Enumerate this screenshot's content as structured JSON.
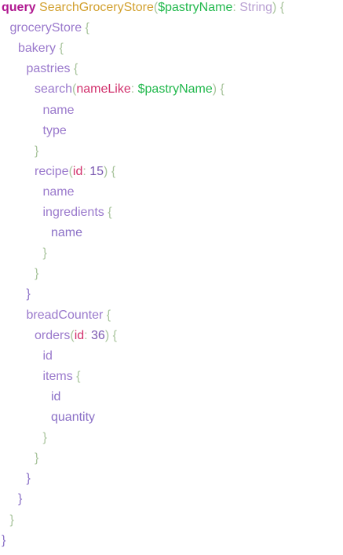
{
  "colors": {
    "keyword": "#b01890",
    "operation": "#d2a02e",
    "variable": "#21b84c",
    "type": "#b9a0d2",
    "field": "#9a79cc",
    "argument": "#d1306c",
    "number": "#7a58b0",
    "punctuation": "#a8c49c"
  },
  "editor": {
    "lines": [
      {
        "indent": 0,
        "tokens": [
          {
            "t": "query",
            "c": "tok-kw"
          },
          {
            "t": " ",
            "c": ""
          },
          {
            "t": "SearchGroceryStore",
            "c": "tok-op"
          },
          {
            "t": "(",
            "c": "tok-punct"
          },
          {
            "t": "$pastryName",
            "c": "tok-var"
          },
          {
            "t": ": ",
            "c": "tok-punct"
          },
          {
            "t": "String",
            "c": "tok-type"
          },
          {
            "t": ") {",
            "c": "tok-punct"
          }
        ]
      },
      {
        "indent": 1,
        "tokens": [
          {
            "t": "groceryStore",
            "c": "tok-field"
          },
          {
            "t": " {",
            "c": "tok-brace"
          }
        ]
      },
      {
        "indent": 2,
        "tokens": [
          {
            "t": "bakery",
            "c": "tok-field"
          },
          {
            "t": " {",
            "c": "tok-brace"
          }
        ]
      },
      {
        "indent": 3,
        "tokens": [
          {
            "t": "pastries",
            "c": "tok-field"
          },
          {
            "t": " {",
            "c": "tok-brace"
          }
        ]
      },
      {
        "indent": 4,
        "tokens": [
          {
            "t": "search",
            "c": "tok-field"
          },
          {
            "t": "(",
            "c": "tok-punct"
          },
          {
            "t": "nameLike",
            "c": "tok-arg"
          },
          {
            "t": ": ",
            "c": "tok-punct"
          },
          {
            "t": "$pastryName",
            "c": "tok-var"
          },
          {
            "t": ") {",
            "c": "tok-punct"
          }
        ]
      },
      {
        "indent": 5,
        "tokens": [
          {
            "t": "name",
            "c": "tok-field"
          }
        ]
      },
      {
        "indent": 5,
        "tokens": [
          {
            "t": "type",
            "c": "tok-field"
          }
        ]
      },
      {
        "indent": 4,
        "tokens": [
          {
            "t": "}",
            "c": "tok-brace"
          }
        ]
      },
      {
        "indent": 4,
        "tokens": [
          {
            "t": "recipe",
            "c": "tok-field"
          },
          {
            "t": "(",
            "c": "tok-punct"
          },
          {
            "t": "id",
            "c": "tok-arg"
          },
          {
            "t": ": ",
            "c": "tok-punct"
          },
          {
            "t": "15",
            "c": "tok-num"
          },
          {
            "t": ") {",
            "c": "tok-punct"
          }
        ]
      },
      {
        "indent": 5,
        "tokens": [
          {
            "t": "name",
            "c": "tok-field"
          }
        ]
      },
      {
        "indent": 5,
        "tokens": [
          {
            "t": "ingredients",
            "c": "tok-field"
          },
          {
            "t": " {",
            "c": "tok-brace"
          }
        ]
      },
      {
        "indent": 6,
        "tokens": [
          {
            "t": "name",
            "c": "tok-def"
          }
        ]
      },
      {
        "indent": 5,
        "tokens": [
          {
            "t": "}",
            "c": "tok-brace"
          }
        ]
      },
      {
        "indent": 4,
        "tokens": [
          {
            "t": "}",
            "c": "tok-brace"
          }
        ]
      },
      {
        "indent": 3,
        "tokens": [
          {
            "t": "}",
            "c": "tok-def"
          }
        ]
      },
      {
        "indent": 3,
        "tokens": [
          {
            "t": "breadCounter",
            "c": "tok-field"
          },
          {
            "t": " {",
            "c": "tok-brace"
          }
        ]
      },
      {
        "indent": 4,
        "tokens": [
          {
            "t": "orders",
            "c": "tok-field"
          },
          {
            "t": "(",
            "c": "tok-punct"
          },
          {
            "t": "id",
            "c": "tok-arg"
          },
          {
            "t": ": ",
            "c": "tok-punct"
          },
          {
            "t": "36",
            "c": "tok-num"
          },
          {
            "t": ") {",
            "c": "tok-punct"
          }
        ]
      },
      {
        "indent": 5,
        "tokens": [
          {
            "t": "id",
            "c": "tok-field"
          }
        ]
      },
      {
        "indent": 5,
        "tokens": [
          {
            "t": "items",
            "c": "tok-field"
          },
          {
            "t": " {",
            "c": "tok-brace"
          }
        ]
      },
      {
        "indent": 6,
        "tokens": [
          {
            "t": "id",
            "c": "tok-def"
          }
        ]
      },
      {
        "indent": 6,
        "tokens": [
          {
            "t": "quantity",
            "c": "tok-def"
          }
        ]
      },
      {
        "indent": 5,
        "tokens": [
          {
            "t": "}",
            "c": "tok-brace"
          }
        ]
      },
      {
        "indent": 4,
        "tokens": [
          {
            "t": "}",
            "c": "tok-brace"
          }
        ]
      },
      {
        "indent": 3,
        "tokens": [
          {
            "t": "}",
            "c": "tok-def"
          }
        ]
      },
      {
        "indent": 2,
        "tokens": [
          {
            "t": "}",
            "c": "tok-def"
          }
        ]
      },
      {
        "indent": 1,
        "tokens": [
          {
            "t": "}",
            "c": "tok-brace"
          }
        ]
      },
      {
        "indent": 0,
        "tokens": [
          {
            "t": "}",
            "c": "tok-def"
          }
        ]
      }
    ]
  }
}
